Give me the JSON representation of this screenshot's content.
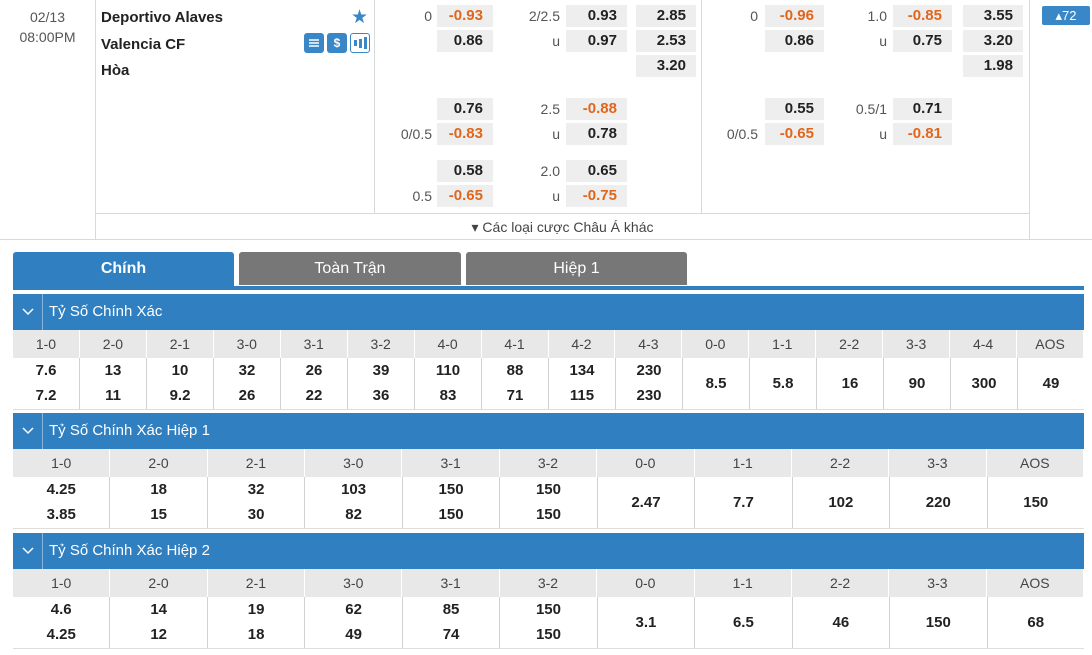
{
  "match": {
    "date": "02/13",
    "time": "08:00PM",
    "home": "Deportivo Alaves",
    "away": "Valencia CF",
    "draw": "Hòa",
    "badge": "▴72",
    "more_label": "▾ Các loại cược Châu Á khác"
  },
  "full_time": {
    "r1": {
      "hcp": "0",
      "home": "-0.93",
      "ou_line": "2/2.5",
      "over": "0.93",
      "x12_1": "2.85"
    },
    "r2": {
      "away": "0.86",
      "ou_u": "u",
      "under": "0.97",
      "x12_2": "2.53"
    },
    "r3": {
      "x12_x": "3.20"
    },
    "r4": {
      "home": "0.76",
      "ou_line": "2.5",
      "over": "-0.88"
    },
    "r5": {
      "hcp": "0/0.5",
      "away": "-0.83",
      "ou_u": "u",
      "under": "0.78"
    },
    "r6": {
      "home": "0.58",
      "ou_line": "2.0",
      "over": "0.65"
    },
    "r7": {
      "hcp": "0.5",
      "away": "-0.65",
      "ou_u": "u",
      "under": "-0.75"
    }
  },
  "half_time": {
    "r1": {
      "hcp": "0",
      "home": "-0.96",
      "ou_line": "1.0",
      "over": "-0.85",
      "x12_1": "3.55"
    },
    "r2": {
      "away": "0.86",
      "ou_u": "u",
      "under": "0.75",
      "x12_2": "3.20"
    },
    "r3": {
      "x12_x": "1.98"
    },
    "r4": {
      "home": "0.55",
      "ou_line": "0.5/1",
      "over": "0.71"
    },
    "r5": {
      "hcp": "0/0.5",
      "away": "-0.65",
      "ou_u": "u",
      "under": "-0.81"
    }
  },
  "tabs": [
    "Chính",
    "Toàn Trận",
    "Hiệp 1"
  ],
  "sections": [
    {
      "title": "Tỷ Số Chính Xác",
      "headers": [
        "1-0",
        "2-0",
        "2-1",
        "3-0",
        "3-1",
        "3-2",
        "4-0",
        "4-1",
        "4-2",
        "4-3",
        "0-0",
        "1-1",
        "2-2",
        "3-3",
        "4-4",
        "AOS"
      ],
      "cells": [
        [
          "7.6",
          "7.2"
        ],
        [
          "13",
          "11"
        ],
        [
          "10",
          "9.2"
        ],
        [
          "32",
          "26"
        ],
        [
          "26",
          "22"
        ],
        [
          "39",
          "36"
        ],
        [
          "110",
          "83"
        ],
        [
          "88",
          "71"
        ],
        [
          "134",
          "115"
        ],
        [
          "230",
          "230"
        ],
        [
          "8.5"
        ],
        [
          "5.8"
        ],
        [
          "16"
        ],
        [
          "90"
        ],
        [
          "300"
        ],
        [
          "49"
        ]
      ]
    },
    {
      "title": "Tỷ Số Chính Xác Hiệp 1",
      "headers": [
        "1-0",
        "2-0",
        "2-1",
        "3-0",
        "3-1",
        "3-2",
        "0-0",
        "1-1",
        "2-2",
        "3-3",
        "AOS"
      ],
      "cells": [
        [
          "4.25",
          "3.85"
        ],
        [
          "18",
          "15"
        ],
        [
          "32",
          "30"
        ],
        [
          "103",
          "82"
        ],
        [
          "150",
          "150"
        ],
        [
          "150",
          "150"
        ],
        [
          "2.47"
        ],
        [
          "7.7"
        ],
        [
          "102"
        ],
        [
          "220"
        ],
        [
          "150"
        ]
      ]
    },
    {
      "title": "Tỷ Số Chính Xác Hiệp 2",
      "headers": [
        "1-0",
        "2-0",
        "2-1",
        "3-0",
        "3-1",
        "3-2",
        "0-0",
        "1-1",
        "2-2",
        "3-3",
        "AOS"
      ],
      "cells": [
        [
          "4.6",
          "4.25"
        ],
        [
          "14",
          "12"
        ],
        [
          "19",
          "18"
        ],
        [
          "62",
          "49"
        ],
        [
          "85",
          "74"
        ],
        [
          "150",
          "150"
        ],
        [
          "3.1"
        ],
        [
          "6.5"
        ],
        [
          "46"
        ],
        [
          "150"
        ],
        [
          "68"
        ]
      ]
    }
  ],
  "colors": {
    "accent": "#2f7fc1",
    "negative": "#e0661b",
    "tab_inactive": "#777777"
  }
}
